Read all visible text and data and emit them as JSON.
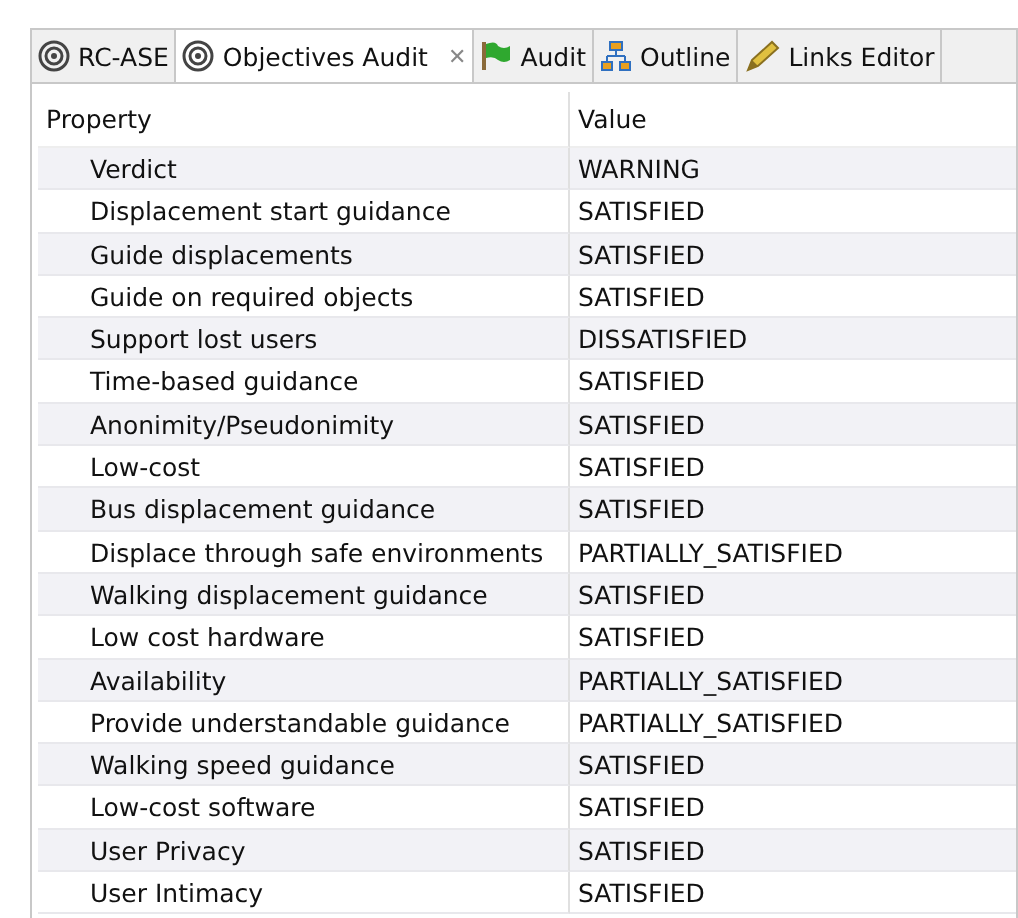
{
  "tabs": [
    {
      "label": "RC-ASE",
      "kind": "target",
      "selected": false
    },
    {
      "label": "Objectives Audit",
      "kind": "target",
      "selected": true,
      "close": "✕"
    },
    {
      "label": "Audit",
      "kind": "flag",
      "selected": false
    },
    {
      "label": "Outline",
      "kind": "hierarchy",
      "selected": false
    },
    {
      "label": "Links Editor",
      "kind": "link",
      "selected": false
    }
  ],
  "table": {
    "columns": [
      "Property",
      "Value"
    ],
    "rows": [
      [
        "Verdict",
        "WARNING"
      ],
      [
        "Displacement start guidance",
        "SATISFIED"
      ],
      [
        "Guide displacements",
        "SATISFIED"
      ],
      [
        "Guide on required objects",
        "SATISFIED"
      ],
      [
        "Support lost users",
        "DISSATISFIED"
      ],
      [
        "Time-based guidance",
        "SATISFIED"
      ],
      [
        "Anonimity/Pseudonimity",
        "SATISFIED"
      ],
      [
        "Low-cost",
        "SATISFIED"
      ],
      [
        "Bus displacement guidance",
        "SATISFIED"
      ],
      [
        "Displace through safe environments",
        "PARTIALLY_SATISFIED"
      ],
      [
        "Walking displacement guidance",
        "SATISFIED"
      ],
      [
        "Low cost hardware",
        "SATISFIED"
      ],
      [
        "Availability",
        "PARTIALLY_SATISFIED"
      ],
      [
        "Provide understandable guidance",
        "PARTIALLY_SATISFIED"
      ],
      [
        "Walking speed guidance",
        "SATISFIED"
      ],
      [
        "Low-cost software",
        "SATISFIED"
      ],
      [
        "User Privacy",
        "SATISFIED"
      ],
      [
        "User Intimacy",
        "SATISFIED"
      ]
    ]
  }
}
